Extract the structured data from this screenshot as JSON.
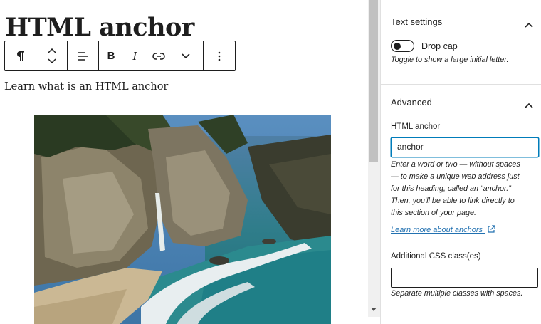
{
  "editor": {
    "heading": "HTML anchor",
    "paragraph": "Learn what is an HTML anchor",
    "next_line_partial": "",
    "toolbar": {
      "buttons": [
        {
          "name": "paragraph",
          "icon": "pilcrow-icon"
        },
        {
          "name": "move",
          "icon": "move-up-down-icon"
        },
        {
          "name": "align",
          "icon": "align-left-icon"
        },
        {
          "name": "bold",
          "icon": "bold-icon",
          "label": "B"
        },
        {
          "name": "italic",
          "icon": "italic-icon",
          "label": "I"
        },
        {
          "name": "link",
          "icon": "link-icon"
        },
        {
          "name": "more-rich-text",
          "icon": "chevron-down-icon"
        },
        {
          "name": "options",
          "icon": "more-vertical-icon"
        }
      ]
    },
    "image": {
      "description_icon": "landscape-photo"
    }
  },
  "sidebar": {
    "text_settings": {
      "title": "Text settings",
      "drop_cap_label": "Drop cap",
      "drop_cap_on": false,
      "drop_cap_help": "Toggle to show a large initial letter."
    },
    "advanced": {
      "title": "Advanced",
      "html_anchor_label": "HTML anchor",
      "html_anchor_value": "anchor",
      "html_anchor_help": [
        "Enter a word or two — without spaces",
        "— to make a unique web address just",
        "for this heading, called an “anchor.”",
        "Then, you'll be able to link directly to",
        "this section of your page."
      ],
      "learn_more": "Learn more about anchors",
      "css_label": "Additional CSS class(es)",
      "css_value": "",
      "css_help": "Separate multiple classes with spaces."
    }
  },
  "colors": {
    "accent": "#007cba",
    "link": "#2271b1",
    "text": "#1e1e1e",
    "divider": "#e0e0e0"
  }
}
